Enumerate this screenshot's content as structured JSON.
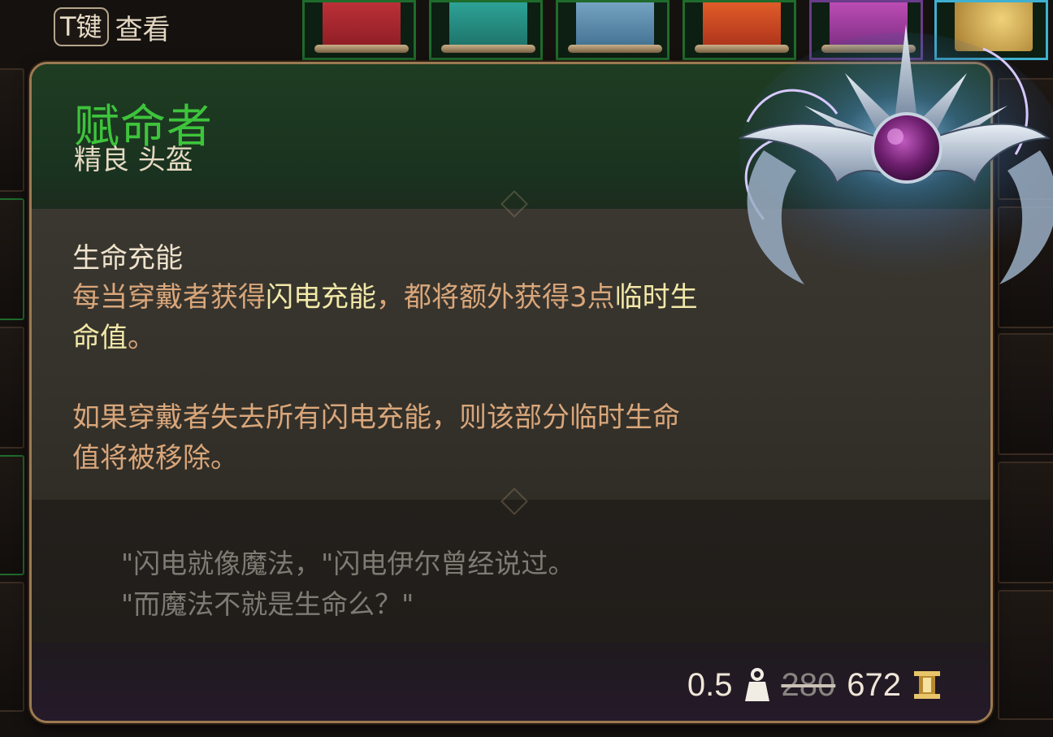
{
  "hint": {
    "key": "T键",
    "label": "查看"
  },
  "item": {
    "name": "赋命者",
    "type": "精良 头盔",
    "name_color": "#3ec43c",
    "rarity_color": "#1f6b2c"
  },
  "passive": {
    "title": "生命充能",
    "desc_a": "每当穿戴者获得",
    "desc_hl": "闪电充能",
    "desc_b": "，都将额外获得3点",
    "desc_hl2": "临时生",
    "desc_hl3": "命值",
    "desc_c": "。",
    "desc2_a": "如果穿戴者失去所有闪电充能，则该部分临时生命",
    "desc2_b": "值将被移除。"
  },
  "flavor": {
    "line1": "\"闪电就像魔法，\"闪电伊尔曾经说过。",
    "line2": "\"而魔法不就是生命么？\""
  },
  "footer": {
    "weight": "0.5",
    "weight_icon": "weight-icon",
    "old_price": "280",
    "price": "672",
    "gold_icon": "gold-icon"
  }
}
